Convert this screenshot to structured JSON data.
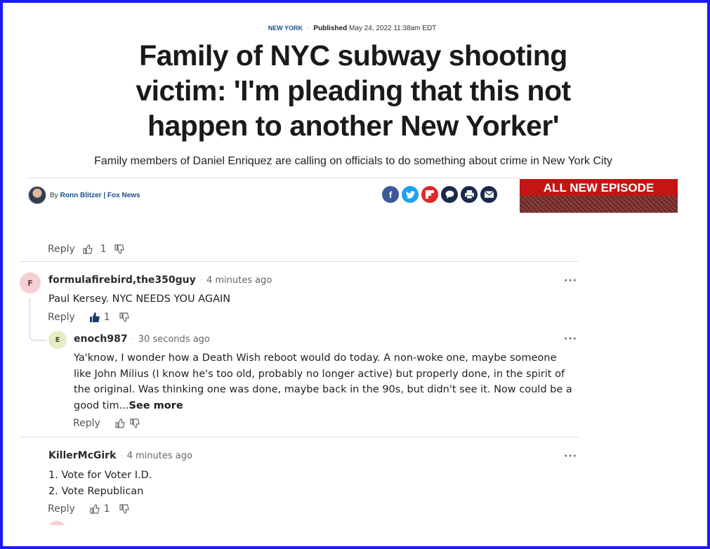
{
  "article": {
    "section": "NEW YORK",
    "published_label": "Published",
    "published_date": "May 24, 2022 11:38am EDT",
    "headline": "Family of NYC subway shooting victim: 'I'm pleading that this not happen to another New Yorker'",
    "subhead": "Family members of Daniel Enriquez are calling on officials to do something about crime in New York City",
    "by_label": "By",
    "author": "Ronn Blitzer | Fox News"
  },
  "share": [
    {
      "icon": "facebook-icon",
      "glyph": "f",
      "color": "#3b5998"
    },
    {
      "icon": "twitter-icon",
      "glyph": "🐦",
      "color": "#1da1f2"
    },
    {
      "icon": "flipboard-icon",
      "glyph": "F",
      "color": "#e12828"
    },
    {
      "icon": "comment-icon",
      "glyph": "💬",
      "color": "#1a2a4a"
    },
    {
      "icon": "print-icon",
      "glyph": "⎙",
      "color": "#1a2a4a"
    },
    {
      "icon": "email-icon",
      "glyph": "✉",
      "color": "#1a2a4a"
    }
  ],
  "ad": {
    "text": "ALL NEW EPISODE"
  },
  "comments": {
    "partial_reply_label": "Reply",
    "partial_like_count": "1",
    "items": [
      {
        "avatar": "F",
        "user": "formulafirebird,the350guy",
        "time": "4 minutes ago",
        "text": "Paul Kersey. NYC NEEDS YOU AGAIN",
        "reply_label": "Reply",
        "likes": "1",
        "more": "···"
      },
      {
        "avatar": "E",
        "user": "enoch987",
        "time": "30 seconds ago",
        "text": "Ya'know, I wonder how a Death Wish reboot would do today.  A non-woke one, maybe someone like John Milius (I know he's too old, probably no longer active) but properly done, in the spirit of the original.  Was thinking one was done, maybe back in the 90s, but didn't see it.  Now could be a good tim...",
        "see_more": "See more",
        "reply_label": "Reply",
        "more": "···"
      },
      {
        "user": "KillerMcGirk",
        "time": "4 minutes ago",
        "line1": "1. Vote for Voter I.D.",
        "line2": "2. Vote Republican",
        "reply_label": "Reply",
        "likes": "1",
        "more": "···"
      }
    ]
  }
}
